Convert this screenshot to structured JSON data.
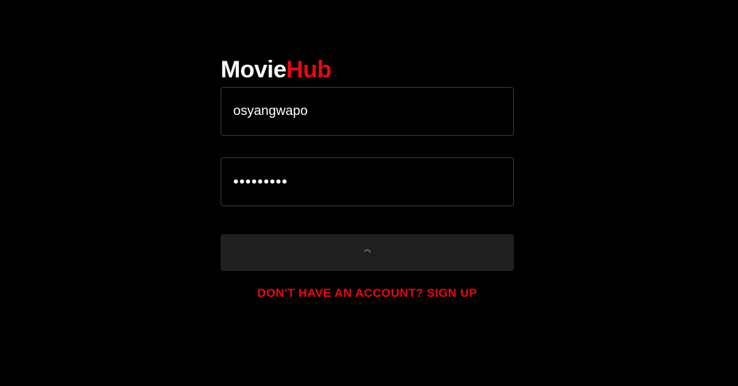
{
  "brand": {
    "name_part1": "Movie",
    "name_part2": "Hub",
    "primary_color": "#ffffff",
    "accent_color": "#e50914"
  },
  "form": {
    "username_value": "osyangwapo",
    "password_value": "•••••••••",
    "submit_state": "loading",
    "submit_icon": "spinner-icon",
    "signup_link": "DON'T HAVE AN ACCOUNT? SIGN UP"
  }
}
